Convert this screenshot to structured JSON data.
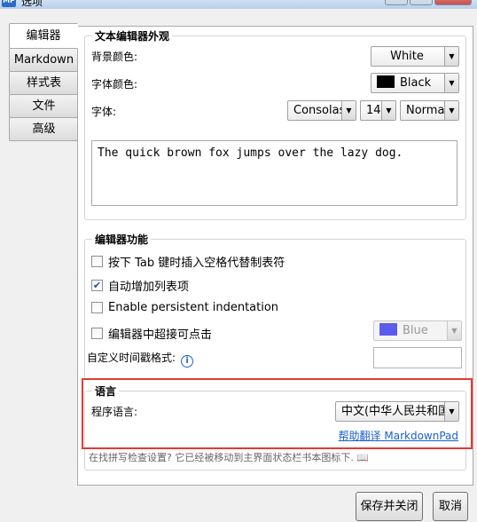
{
  "window": {
    "app_icon_text": "MP",
    "title": "选项"
  },
  "tabs": [
    {
      "label": "编辑器"
    },
    {
      "label": "Markdown"
    },
    {
      "label": "样式表"
    },
    {
      "label": "文件"
    },
    {
      "label": "高级"
    }
  ],
  "appearance": {
    "legend": "文本编辑器外观",
    "bg_label": "背景颜色:",
    "bg_value": "White",
    "fg_label": "字体颜色:",
    "fg_value": "Black",
    "font_label": "字体:",
    "font_family": "Consolas",
    "font_size": "14",
    "font_weight": "Normal",
    "preview_text": "The quick brown fox jumps over the lazy dog."
  },
  "editor_features": {
    "legend": "编辑器功能",
    "tab_spaces": {
      "label": "按下 Tab 键时插入空格代替制表符",
      "checked": false
    },
    "auto_list": {
      "label": "自动增加列表项",
      "checked": true
    },
    "persistent_indent": {
      "label": "Enable persistent indentation",
      "checked": false
    },
    "clickable_links": {
      "label": "编辑器中超接可点击",
      "checked": false
    },
    "link_color": "Blue",
    "link_color_hex": "#5b5bf0",
    "timestamp_label": "自定义时间戳格式:",
    "timestamp_value": ""
  },
  "language": {
    "legend": "语言",
    "label": "程序语言:",
    "value": "中文(中华人民共和国)",
    "help_link": "帮助翻译 MarkdownPad"
  },
  "note": "在找拼写检查设置? 它已经被移动到主界面状态栏书本图标下.",
  "buttons": {
    "save_close": "保存并关闭",
    "cancel": "取消"
  }
}
